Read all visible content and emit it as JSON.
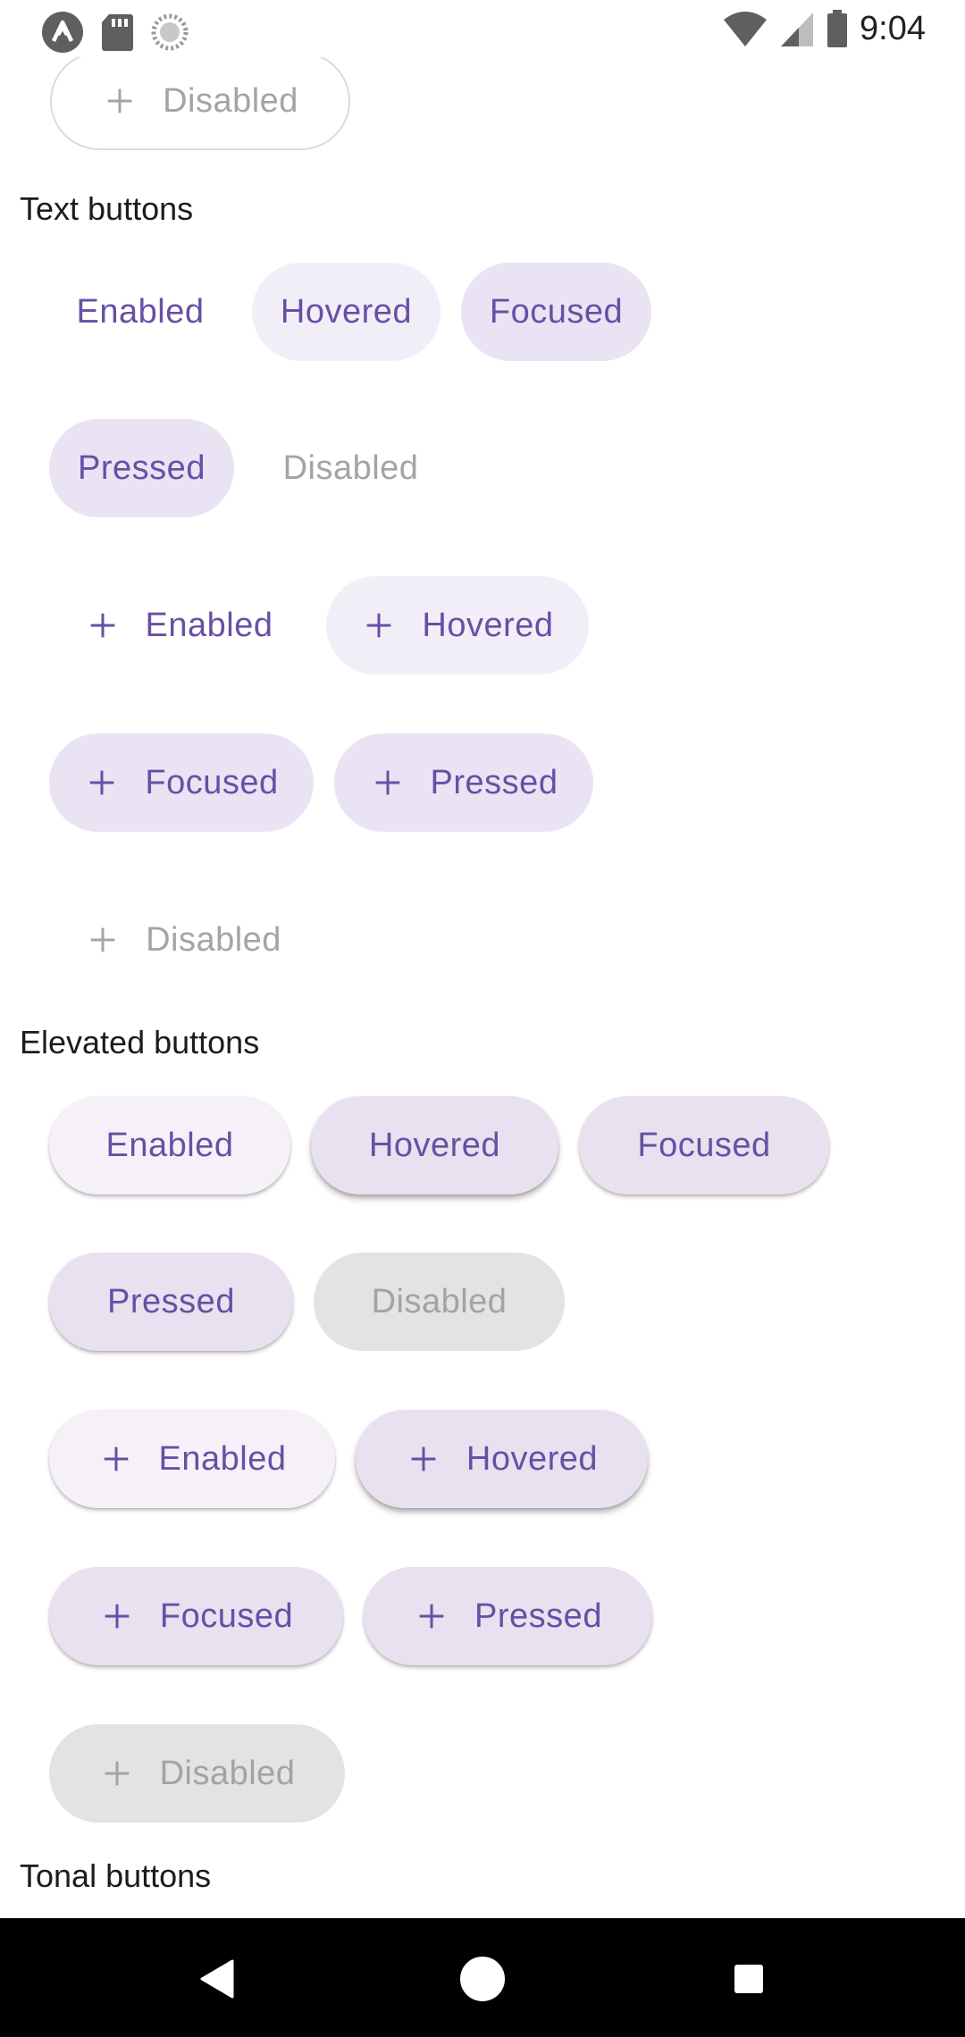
{
  "status_bar": {
    "time": "9:04",
    "left_icons": [
      "app-logo-icon",
      "sd-card-icon",
      "sync-icon"
    ],
    "right_icons": [
      "wifi-icon",
      "signal-icon",
      "battery-icon"
    ]
  },
  "top_partial": {
    "label": "Disabled",
    "icon": "plus-icon"
  },
  "sections": {
    "text": {
      "title": "Text buttons",
      "row1": [
        "Enabled",
        "Hovered",
        "Focused"
      ],
      "row2": [
        "Pressed",
        "Disabled"
      ],
      "icon_row1": [
        "Enabled",
        "Hovered"
      ],
      "icon_row2": [
        "Focused",
        "Pressed"
      ],
      "icon_row3": [
        "Disabled"
      ]
    },
    "elevated": {
      "title": "Elevated buttons",
      "row1": [
        "Enabled",
        "Hovered",
        "Focused"
      ],
      "row2": [
        "Pressed",
        "Disabled"
      ],
      "icon_row1": [
        "Enabled",
        "Hovered"
      ],
      "icon_row2": [
        "Focused",
        "Pressed"
      ],
      "icon_row3": [
        "Disabled"
      ]
    },
    "tonal": {
      "title": "Tonal buttons"
    }
  },
  "colors": {
    "primary": "#6750a4",
    "disabled_text": "#a5a3a8",
    "hover_container": "#f2eef8",
    "focus_container": "#e9e3f4",
    "elevated_container": "#f6f1f8",
    "nav_bar": "#000000"
  },
  "nav_bar": {
    "buttons": [
      "back-icon",
      "home-icon",
      "recents-icon"
    ]
  }
}
